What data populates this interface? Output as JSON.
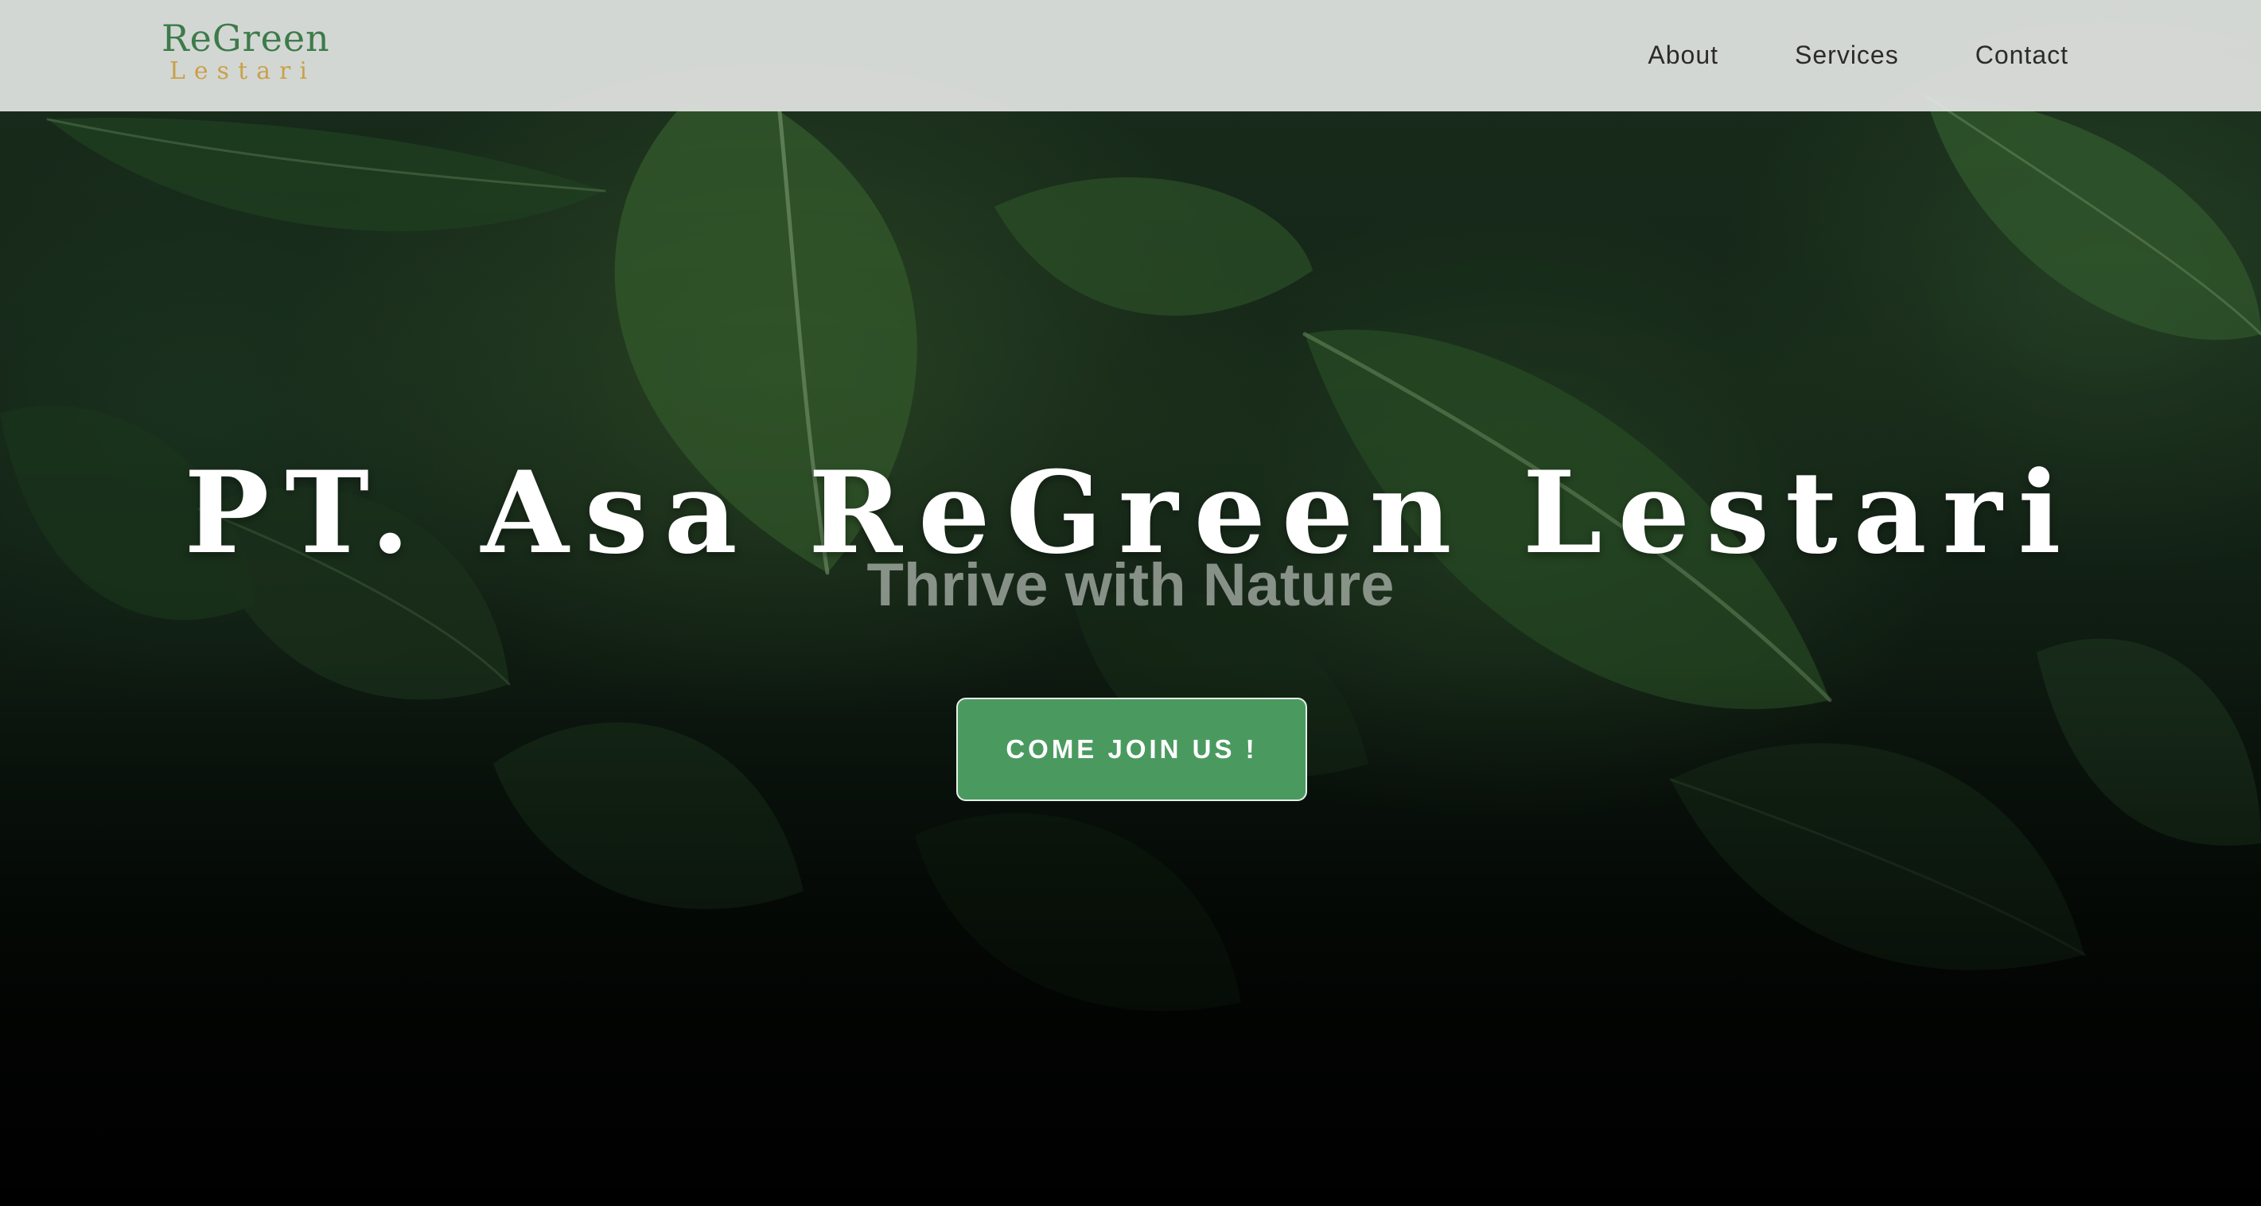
{
  "brand": {
    "logo_top": "ReGreen",
    "logo_bottom": "Lestari",
    "logo_icon": "leaf-icon"
  },
  "nav": {
    "items": [
      {
        "label": "About"
      },
      {
        "label": "Services"
      },
      {
        "label": "Contact"
      }
    ]
  },
  "hero": {
    "title": "PT. Asa ReGreen Lestari",
    "subtitle": "Thrive with Nature",
    "cta_label": "COME JOIN US !",
    "background": "tropical-leaves-photo"
  },
  "colors": {
    "brand_green": "#3d7b49",
    "brand_gold": "#c9a04a",
    "cta_green": "#4a9a60",
    "navbar_bg": "#e2e4e2"
  }
}
